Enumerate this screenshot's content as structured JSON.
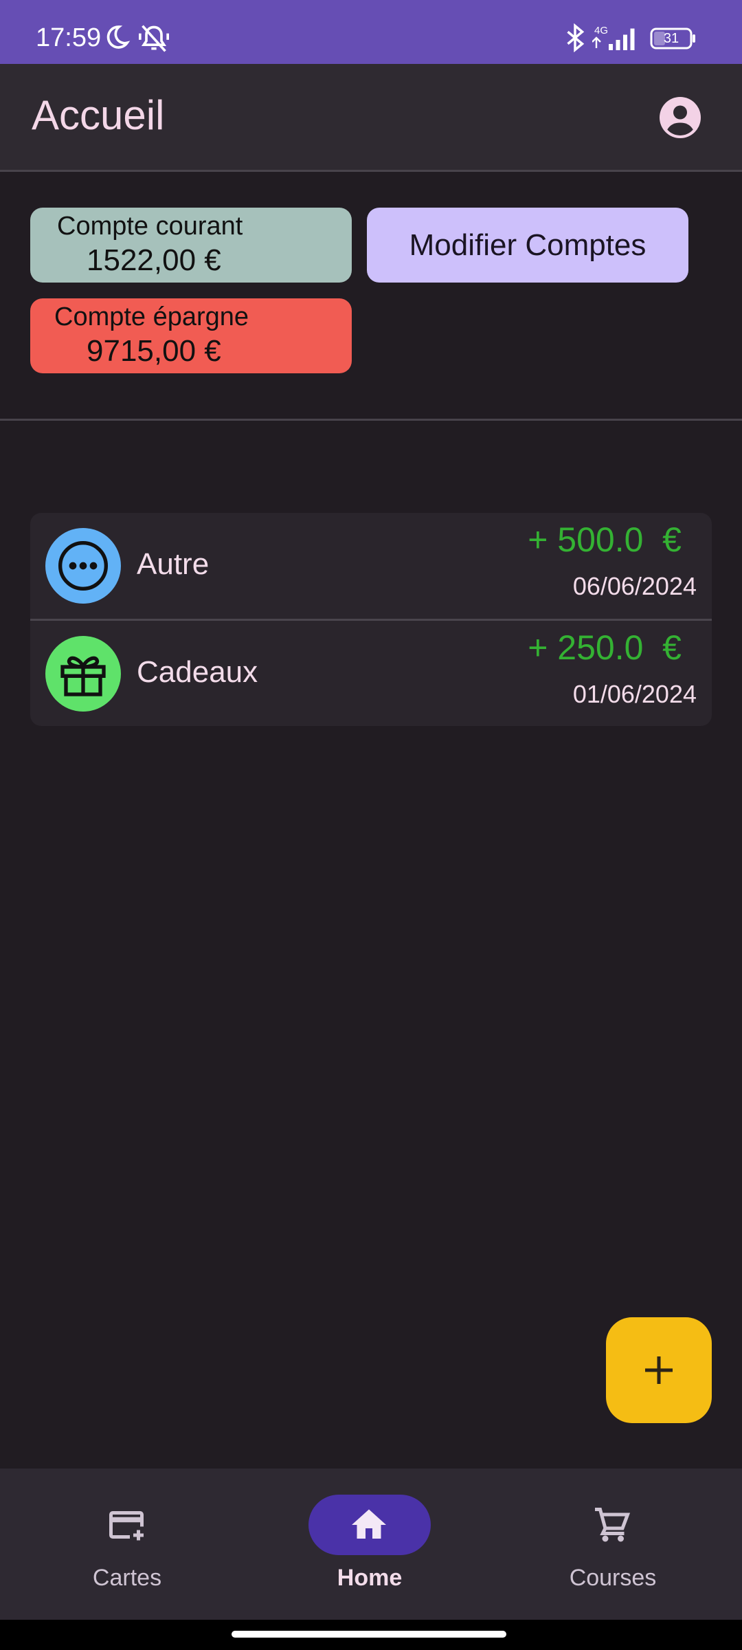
{
  "status_bar": {
    "time": "17:59",
    "network": "4G",
    "battery": "31",
    "icons": [
      "moon-icon",
      "silent-icon",
      "bluetooth-icon",
      "signal-icon",
      "battery-icon"
    ]
  },
  "app_bar": {
    "title": "Accueil",
    "account_icon": "account-circle-icon"
  },
  "accounts": [
    {
      "name": "Compte courant",
      "amount": "1522,00 €",
      "color": "#a6c1bb"
    },
    {
      "name": "Compte épargne",
      "amount": "9715,00 €",
      "color": "#f15c53"
    }
  ],
  "edit_button": {
    "label": "Modifier Comptes"
  },
  "transactions": [
    {
      "label": "Autre",
      "amount": "+ 500.0  €",
      "date": "06/06/2024",
      "icon": "more-horizontal-icon",
      "color": "#62b2f6"
    },
    {
      "label": "Cadeaux",
      "amount": "+ 250.0  €",
      "date": "01/06/2024",
      "icon": "gift-icon",
      "color": "#5fe26a"
    }
  ],
  "fab": {
    "icon": "plus-icon",
    "color": "#f5bd14"
  },
  "bottom_nav": {
    "items": [
      {
        "label": "Cartes",
        "icon": "add-card-icon",
        "active": false
      },
      {
        "label": "Home",
        "icon": "home-icon",
        "active": true
      },
      {
        "label": "Courses",
        "icon": "shopping-cart-icon",
        "active": false
      }
    ]
  },
  "colors": {
    "status_bar": "#664eb4",
    "background": "#211c22",
    "income": "#34b233",
    "active_nav": "#4a32a8"
  }
}
